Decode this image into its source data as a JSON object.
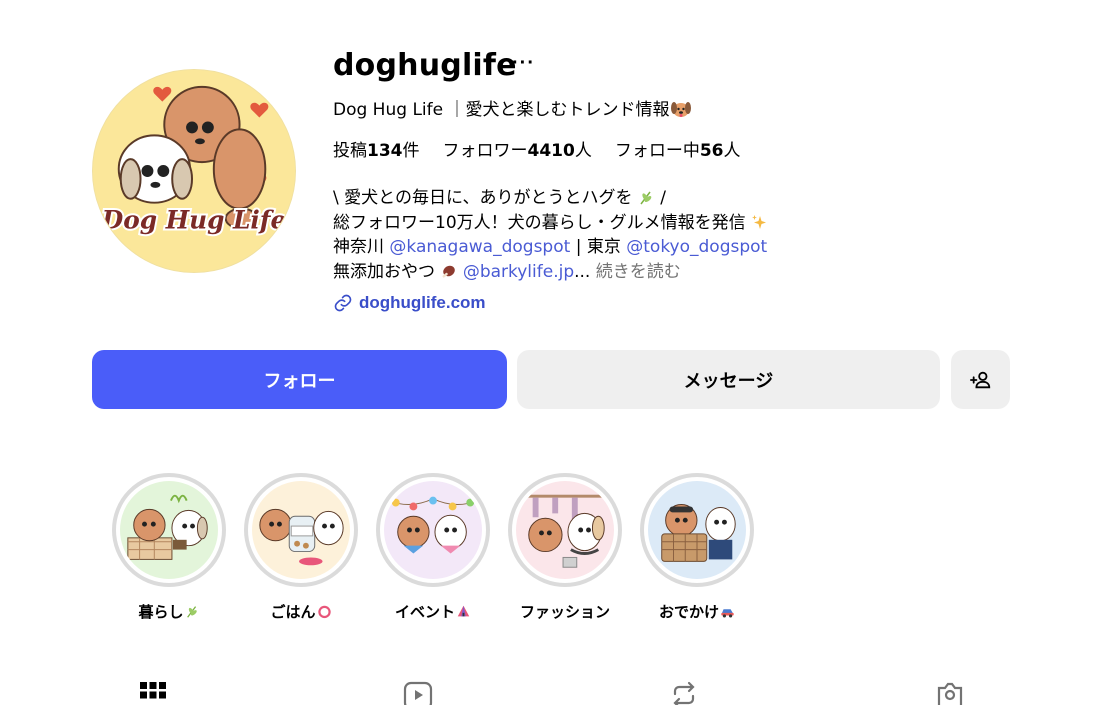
{
  "profile": {
    "username": "doghuglife",
    "more_label": "···",
    "full_name": "Dog Hug Life ｜愛犬と楽しむトレンド情報",
    "avatar_text": "Dog Hug Life",
    "stats": {
      "posts_label": "投稿",
      "posts_value": "134",
      "posts_unit": "件",
      "followers_label": "フォロワー",
      "followers_value": "4410",
      "followers_unit": "人",
      "following_label": "フォロー中",
      "following_value": "56",
      "following_unit": "人"
    },
    "bio": {
      "line1": "\\ 愛犬との毎日に、ありがとうとハグを",
      "line1_end": " /",
      "line2": "総フォロワー10万人！犬の暮らし・グルメ情報を発信",
      "line3_prefix": "神奈川 ",
      "line3_link1": "@kanagawa_dogspot",
      "line3_mid": " | 東京 ",
      "line3_link2": "@tokyo_dogspot",
      "line4_prefix": "無添加おやつ",
      "line4_link": "@barkylife.jp",
      "line4_ellipsis": "...",
      "read_more": " 続きを読む"
    },
    "website": "doghuglife.com"
  },
  "actions": {
    "follow_label": "フォロー",
    "message_label": "メッセージ"
  },
  "highlights": [
    {
      "label": "暮らし"
    },
    {
      "label": "ごはん"
    },
    {
      "label": "イベント"
    },
    {
      "label": "ファッション"
    },
    {
      "label": "おでかけ"
    }
  ],
  "colors": {
    "accent": "#4a5df9",
    "link": "#4a5bd4",
    "button_gray": "#efefef",
    "avatar_bg": "#fbe79a"
  },
  "tabs": [
    "grid-icon",
    "reels-icon",
    "reposts-icon",
    "tagged-icon"
  ]
}
